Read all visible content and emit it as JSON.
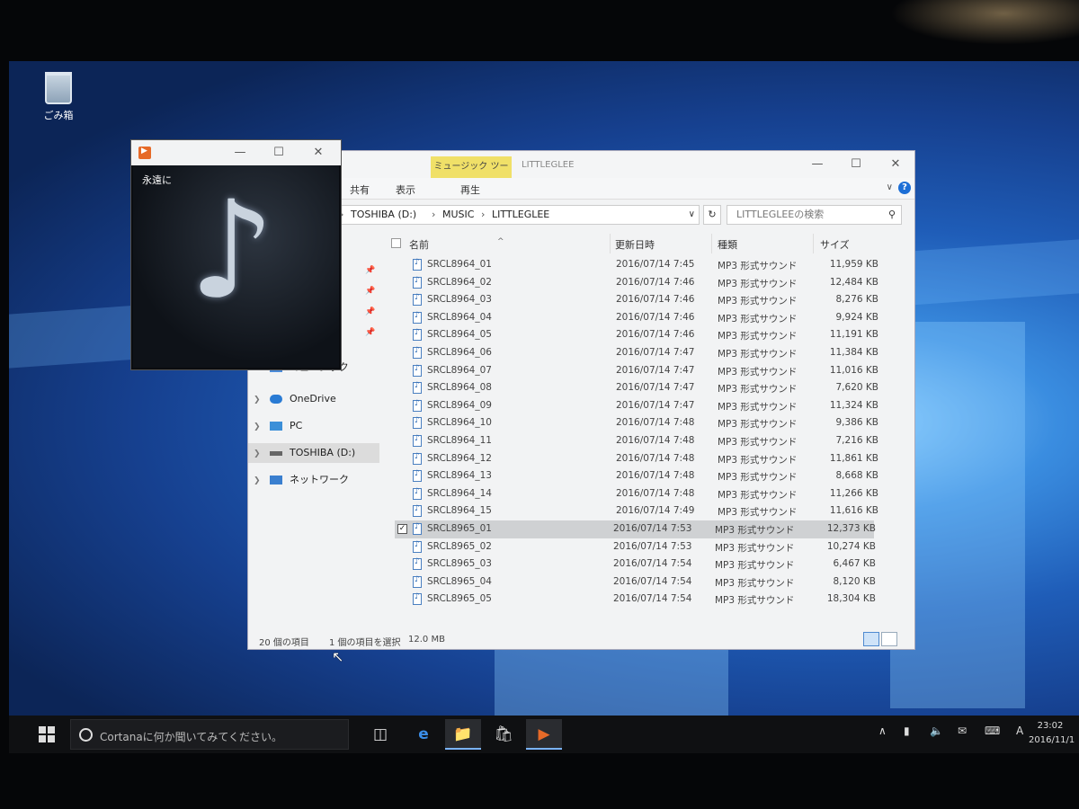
{
  "desktop": {
    "recycle_bin_label": "ごみ箱"
  },
  "explorer": {
    "contextual_tab": "ミュージック ツール",
    "title": "LITTLEGLEE",
    "ribbon_tabs": [
      "共有",
      "表示",
      "再生"
    ],
    "address": [
      "TOSHIBA (D:)",
      "MUSIC",
      "LITTLEGLEE"
    ],
    "search_placeholder": "LITTLEGLEEの検索",
    "nav_items": [
      {
        "label": "ミュージック",
        "icon": "music-folder-icon"
      },
      {
        "label": "OneDrive",
        "icon": "cloud-icon"
      },
      {
        "label": "PC",
        "icon": "monitor-icon"
      },
      {
        "label": "TOSHIBA (D:)",
        "icon": "drive-icon",
        "selected": true
      },
      {
        "label": "ネットワーク",
        "icon": "network-icon"
      }
    ],
    "columns": [
      "名前",
      "更新日時",
      "種類",
      "サイズ"
    ],
    "files": [
      {
        "name": "SRCL8964_01",
        "date": "2016/07/14 7:45",
        "type": "MP3 形式サウンド",
        "size": "11,959 KB"
      },
      {
        "name": "SRCL8964_02",
        "date": "2016/07/14 7:46",
        "type": "MP3 形式サウンド",
        "size": "12,484 KB"
      },
      {
        "name": "SRCL8964_03",
        "date": "2016/07/14 7:46",
        "type": "MP3 形式サウンド",
        "size": "8,276 KB"
      },
      {
        "name": "SRCL8964_04",
        "date": "2016/07/14 7:46",
        "type": "MP3 形式サウンド",
        "size": "9,924 KB"
      },
      {
        "name": "SRCL8964_05",
        "date": "2016/07/14 7:46",
        "type": "MP3 形式サウンド",
        "size": "11,191 KB"
      },
      {
        "name": "SRCL8964_06",
        "date": "2016/07/14 7:47",
        "type": "MP3 形式サウンド",
        "size": "11,384 KB"
      },
      {
        "name": "SRCL8964_07",
        "date": "2016/07/14 7:47",
        "type": "MP3 形式サウンド",
        "size": "11,016 KB"
      },
      {
        "name": "SRCL8964_08",
        "date": "2016/07/14 7:47",
        "type": "MP3 形式サウンド",
        "size": "7,620 KB"
      },
      {
        "name": "SRCL8964_09",
        "date": "2016/07/14 7:47",
        "type": "MP3 形式サウンド",
        "size": "11,324 KB"
      },
      {
        "name": "SRCL8964_10",
        "date": "2016/07/14 7:48",
        "type": "MP3 形式サウンド",
        "size": "9,386 KB"
      },
      {
        "name": "SRCL8964_11",
        "date": "2016/07/14 7:48",
        "type": "MP3 形式サウンド",
        "size": "7,216 KB"
      },
      {
        "name": "SRCL8964_12",
        "date": "2016/07/14 7:48",
        "type": "MP3 形式サウンド",
        "size": "11,861 KB"
      },
      {
        "name": "SRCL8964_13",
        "date": "2016/07/14 7:48",
        "type": "MP3 形式サウンド",
        "size": "8,668 KB"
      },
      {
        "name": "SRCL8964_14",
        "date": "2016/07/14 7:48",
        "type": "MP3 形式サウンド",
        "size": "11,266 KB"
      },
      {
        "name": "SRCL8964_15",
        "date": "2016/07/14 7:49",
        "type": "MP3 形式サウンド",
        "size": "11,616 KB"
      },
      {
        "name": "SRCL8965_01",
        "date": "2016/07/14 7:53",
        "type": "MP3 形式サウンド",
        "size": "12,373 KB",
        "selected": true
      },
      {
        "name": "SRCL8965_02",
        "date": "2016/07/14 7:53",
        "type": "MP3 形式サウンド",
        "size": "10,274 KB"
      },
      {
        "name": "SRCL8965_03",
        "date": "2016/07/14 7:54",
        "type": "MP3 形式サウンド",
        "size": "6,467 KB"
      },
      {
        "name": "SRCL8965_04",
        "date": "2016/07/14 7:54",
        "type": "MP3 形式サウンド",
        "size": "8,120 KB"
      },
      {
        "name": "SRCL8965_05",
        "date": "2016/07/14 7:54",
        "type": "MP3 形式サウンド",
        "size": "18,304 KB"
      }
    ],
    "status_count": "20 個の項目",
    "status_selection": "1 個の項目を選択",
    "status_size": "12.0 MB"
  },
  "player": {
    "track_title": "永遠に"
  },
  "taskbar": {
    "cortana_placeholder": "Cortanaに何か聞いてみてください。",
    "ime": "A",
    "time": "23:02",
    "date": "2016/11/1"
  },
  "colors": {
    "accent": "#1d6fd6",
    "music_tool_tab": "#f0e068",
    "selection": "#cfd1d3"
  }
}
